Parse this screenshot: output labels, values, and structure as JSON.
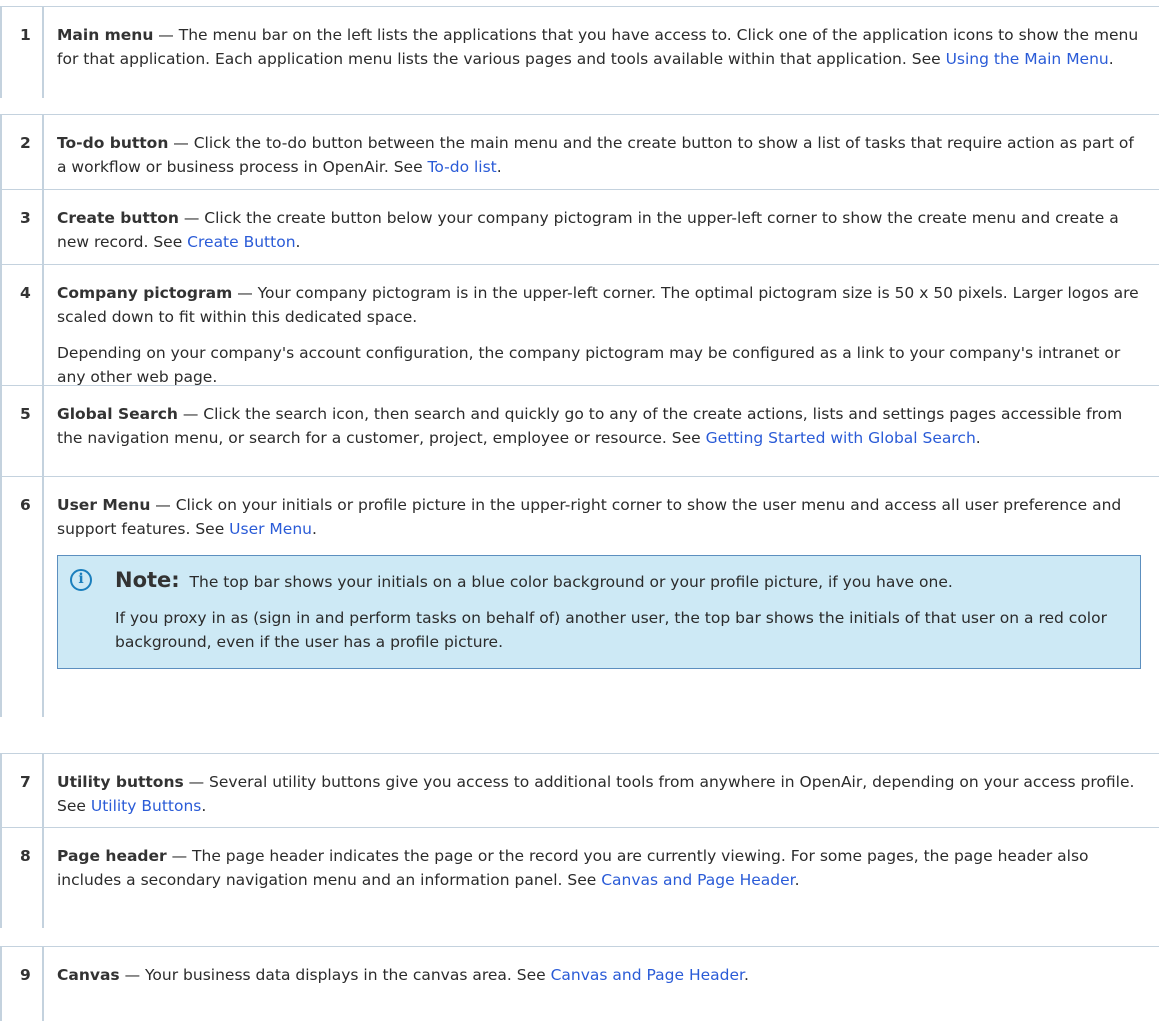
{
  "rows": [
    {
      "num": "1",
      "term": "Main menu",
      "text": " — The menu bar on the left lists the applications that you have access to. Click one of the application icons to show the menu for that application. Each application menu lists the various pages and tools available within that application. See ",
      "link": "Using the Main Menu",
      "after": "."
    },
    {
      "num": "2",
      "term": "To-do button",
      "text": " — Click the to-do button between the main menu and the create button to show a list of tasks that require action as part of a workflow or business process in OpenAir. See ",
      "link": "To-do list",
      "after": "."
    },
    {
      "num": "3",
      "term": "Create button",
      "text": " — Click the create button below your company pictogram in the upper-left corner to show the create menu and create a new record. See ",
      "link": "Create Button",
      "after": "."
    },
    {
      "num": "4",
      "term": "Company pictogram",
      "text": " — Your company pictogram is in the upper-left corner. The optimal pictogram size is 50 x 50 pixels. Larger logos are scaled down to fit within this dedicated space.",
      "para2": "Depending on your company's account configuration, the company pictogram may be configured as a link to your company's intranet or any other web page."
    },
    {
      "num": "5",
      "term": "Global Search",
      "text": " — Click the search icon, then search and quickly go to any of the create actions, lists and settings pages accessible from the navigation menu, or search for a customer, project, employee or resource. See ",
      "link": "Getting Started with Global Search",
      "after": "."
    },
    {
      "num": "6",
      "term": "User Menu",
      "text": " — Click on your initials or profile picture in the upper-right corner to show the user menu and access all user preference and support features. See ",
      "link": "User Menu",
      "after": ".",
      "note": {
        "title": "Note:",
        "p1": "The top bar shows your initials on a blue color background or your profile picture, if you have one.",
        "p2": "If you proxy in as (sign in and perform tasks on behalf of) another user, the top bar shows the initials of that user on a red color background, even if the user has a profile picture."
      }
    },
    {
      "num": "7",
      "term": "Utility buttons",
      "text": " — Several utility buttons give you access to additional tools from anywhere in OpenAir, depending on your access profile. See ",
      "link": "Utility Buttons",
      "after": "."
    },
    {
      "num": "8",
      "term": "Page header",
      "text": " — The page header indicates the page or the record you are currently viewing. For some pages, the page header also includes a secondary navigation menu and an information panel. See ",
      "link": "Canvas and Page Header",
      "after": "."
    },
    {
      "num": "9",
      "term": "Canvas",
      "text": " — Your business data displays in the canvas area. See ",
      "link": "Canvas and Page Header",
      "after": "."
    }
  ],
  "colors": {
    "link": "#2a5bd7",
    "note_bg": "#cde9f5",
    "note_border": "#5c8fbf",
    "rule": "#c4d2de"
  },
  "icons": {
    "note": "info-circle-icon"
  }
}
